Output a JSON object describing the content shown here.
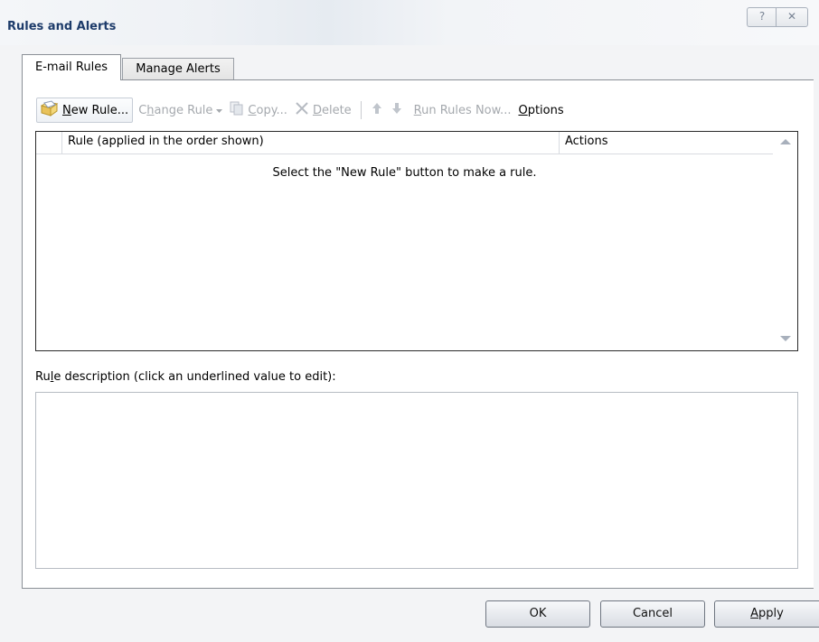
{
  "window": {
    "title": "Rules and Alerts",
    "help_glyph": "?",
    "close_glyph": "✕"
  },
  "tabs": [
    {
      "label": "E-mail Rules",
      "active": true
    },
    {
      "label": "Manage Alerts",
      "active": false
    }
  ],
  "toolbar": {
    "new_rule": {
      "prefix": "",
      "accel": "N",
      "rest": "ew Rule..."
    },
    "change_rule": {
      "prefix": "C",
      "accel": "h",
      "rest": "ange Rule"
    },
    "copy": {
      "prefix": "",
      "accel": "C",
      "rest": "opy..."
    },
    "delete": {
      "prefix": "",
      "accel": "D",
      "rest": "elete"
    },
    "run_rules_now": {
      "prefix": "",
      "accel": "R",
      "rest": "un Rules Now..."
    },
    "options": {
      "prefix": "",
      "accel": "O",
      "rest": "ptions"
    }
  },
  "rules_list": {
    "columns": [
      "Rule (applied in the order shown)",
      "Actions"
    ],
    "empty_message": "Select the \"New Rule\" button to make a rule."
  },
  "description": {
    "label_prefix": "Ru",
    "label_accel": "l",
    "label_rest": "e description (click an underlined value to edit):"
  },
  "buttons": {
    "ok": "OK",
    "cancel": "Cancel",
    "apply_accel": "A",
    "apply_rest": "pply"
  },
  "colors": {
    "title_text": "#1d3b6a",
    "disabled_text": "#a5a9ae",
    "dialog_bg": "#f3f4f6"
  },
  "icons": {
    "new_rule": "new-rule-icon",
    "copy": "copy-icon",
    "delete": "delete-icon",
    "move_up": "arrow-up-icon",
    "move_down": "arrow-down-icon"
  }
}
